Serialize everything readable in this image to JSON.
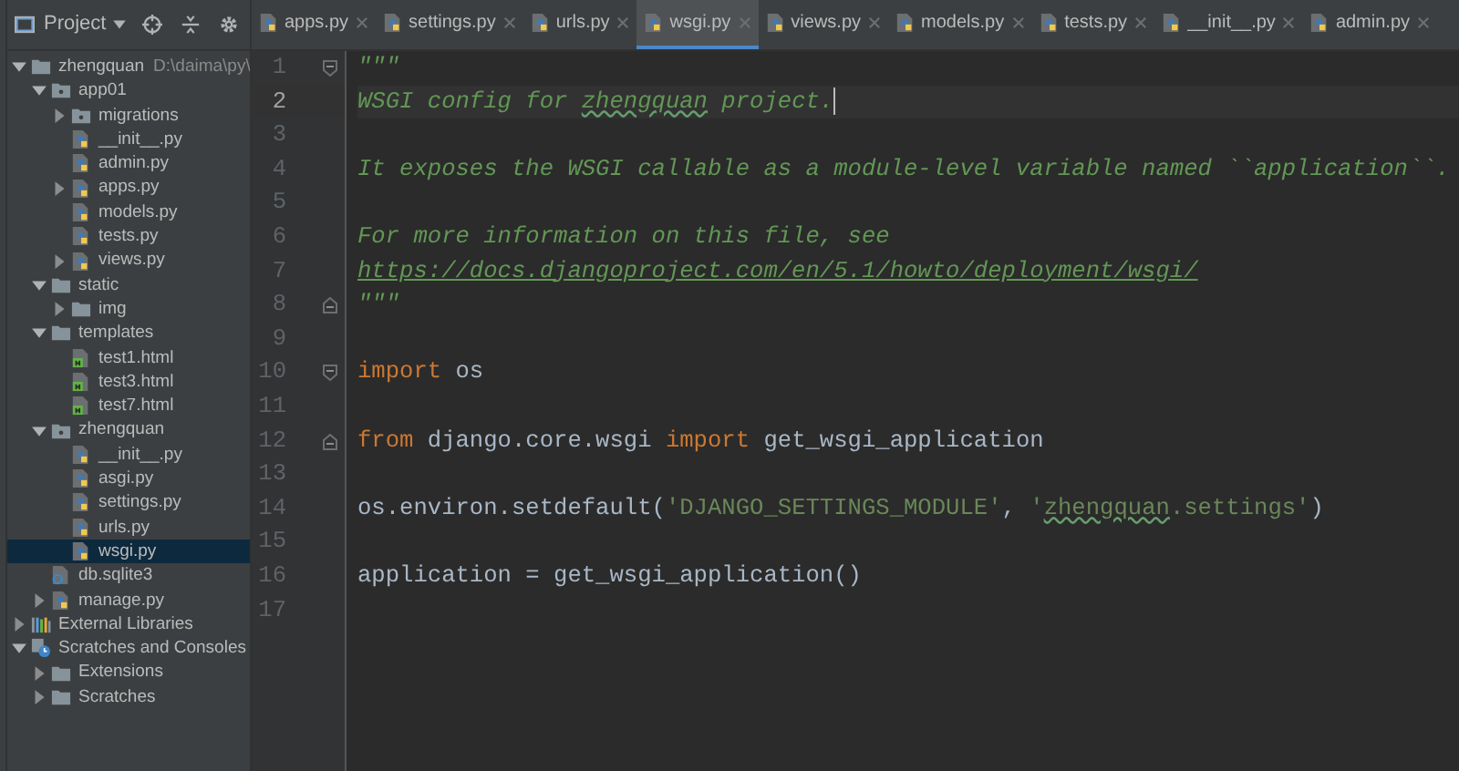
{
  "project_panel": {
    "title": "Project"
  },
  "tabs": [
    {
      "label": "apps.py",
      "selected": false
    },
    {
      "label": "settings.py",
      "selected": false
    },
    {
      "label": "urls.py",
      "selected": false
    },
    {
      "label": "wsgi.py",
      "selected": true
    },
    {
      "label": "views.py",
      "selected": false
    },
    {
      "label": "models.py",
      "selected": false
    },
    {
      "label": "tests.py",
      "selected": false
    },
    {
      "label": "__init__.py",
      "selected": false
    },
    {
      "label": "admin.py",
      "selected": false
    }
  ],
  "tree": [
    {
      "label": "zhengquan",
      "kind": "folder",
      "path": "D:\\daima\\py\\",
      "expanded": true,
      "selected": false,
      "children": [
        {
          "label": "app01",
          "kind": "package",
          "expanded": true,
          "selected": false,
          "children": [
            {
              "label": "migrations",
              "kind": "package",
              "expanded": false,
              "selected": false
            },
            {
              "label": "__init__.py",
              "kind": "python",
              "selected": false
            },
            {
              "label": "admin.py",
              "kind": "python",
              "selected": false
            },
            {
              "label": "apps.py",
              "kind": "python",
              "expanded": false,
              "selected": false
            },
            {
              "label": "models.py",
              "kind": "python",
              "selected": false
            },
            {
              "label": "tests.py",
              "kind": "python",
              "selected": false
            },
            {
              "label": "views.py",
              "kind": "python",
              "expanded": false,
              "selected": false
            }
          ]
        },
        {
          "label": "static",
          "kind": "folder",
          "expanded": true,
          "selected": false,
          "children": [
            {
              "label": "img",
              "kind": "folder",
              "expanded": false,
              "selected": false
            }
          ]
        },
        {
          "label": "templates",
          "kind": "folder",
          "expanded": true,
          "selected": false,
          "children": [
            {
              "label": "test1.html",
              "kind": "html",
              "selected": false
            },
            {
              "label": "test3.html",
              "kind": "html",
              "selected": false
            },
            {
              "label": "test7.html",
              "kind": "html",
              "selected": false
            }
          ]
        },
        {
          "label": "zhengquan",
          "kind": "package",
          "expanded": true,
          "selected": false,
          "children": [
            {
              "label": "__init__.py",
              "kind": "python",
              "selected": false
            },
            {
              "label": "asgi.py",
              "kind": "python",
              "selected": false
            },
            {
              "label": "settings.py",
              "kind": "python",
              "selected": false
            },
            {
              "label": "urls.py",
              "kind": "python",
              "selected": false
            },
            {
              "label": "wsgi.py",
              "kind": "python",
              "selected": true
            }
          ]
        },
        {
          "label": "db.sqlite3",
          "kind": "database",
          "selected": false
        },
        {
          "label": "manage.py",
          "kind": "python",
          "expanded": false,
          "selected": false
        }
      ]
    },
    {
      "label": "External Libraries",
      "kind": "libraries",
      "expanded": false,
      "selected": false
    },
    {
      "label": "Scratches and Consoles",
      "kind": "scratches",
      "expanded": true,
      "selected": false,
      "children": [
        {
          "label": "Extensions",
          "kind": "folder",
          "expanded": false,
          "selected": false
        },
        {
          "label": "Scratches",
          "kind": "folder",
          "expanded": false,
          "selected": false
        }
      ]
    }
  ],
  "code_lines": [
    {
      "number": "1",
      "current": false,
      "fold_start": true,
      "tokens": [
        {
          "text": "\"\"\"",
          "kind": "doc"
        }
      ]
    },
    {
      "number": "2",
      "current": true,
      "tokens": [
        {
          "text": "WSGI config for ",
          "kind": "doc"
        },
        {
          "text": "zhengquan",
          "kind": "doc-typo"
        },
        {
          "text": " project.",
          "kind": "doc"
        }
      ]
    },
    {
      "number": "3",
      "current": false
    },
    {
      "number": "4",
      "current": false,
      "tokens": [
        {
          "text": "It exposes the WSGI callable as a module-level variable named ``application``.",
          "kind": "doc"
        }
      ]
    },
    {
      "number": "5",
      "current": false
    },
    {
      "number": "6",
      "current": false,
      "tokens": [
        {
          "text": "For more information on this file, see",
          "kind": "doc"
        }
      ]
    },
    {
      "number": "7",
      "current": false,
      "tokens": [
        {
          "text": "https://docs.djangoproject.com/en/5.1/howto/deployment/wsgi/",
          "kind": "link"
        }
      ]
    },
    {
      "number": "8",
      "current": false,
      "fold_end": true,
      "tokens": [
        {
          "text": "\"\"\"",
          "kind": "doc"
        }
      ]
    },
    {
      "number": "9",
      "current": false
    },
    {
      "number": "10",
      "current": false,
      "fold_start": true,
      "tokens": [
        {
          "text": "import",
          "kind": "keyword"
        },
        {
          "text": " os",
          "kind": "plain"
        }
      ]
    },
    {
      "number": "11",
      "current": false
    },
    {
      "number": "12",
      "current": false,
      "fold_end": true,
      "tokens": [
        {
          "text": "from",
          "kind": "keyword"
        },
        {
          "text": " django.core.wsgi ",
          "kind": "plain"
        },
        {
          "text": "import",
          "kind": "keyword"
        },
        {
          "text": " get_wsgi_application",
          "kind": "plain"
        }
      ]
    },
    {
      "number": "13",
      "current": false
    },
    {
      "number": "14",
      "current": false,
      "tokens": [
        {
          "text": "os.environ.setdefault(",
          "kind": "plain"
        },
        {
          "text": "'DJANGO_SETTINGS_MODULE'",
          "kind": "string"
        },
        {
          "text": ", ",
          "kind": "plain"
        },
        {
          "text": "'",
          "kind": "string"
        },
        {
          "text": "zhengquan",
          "kind": "string-typo"
        },
        {
          "text": ".settings'",
          "kind": "string"
        },
        {
          "text": ")",
          "kind": "plain"
        }
      ]
    },
    {
      "number": "15",
      "current": false
    },
    {
      "number": "16",
      "current": false,
      "tokens": [
        {
          "text": "application = get_wsgi_application()",
          "kind": "plain"
        }
      ]
    },
    {
      "number": "17",
      "current": false
    }
  ]
}
